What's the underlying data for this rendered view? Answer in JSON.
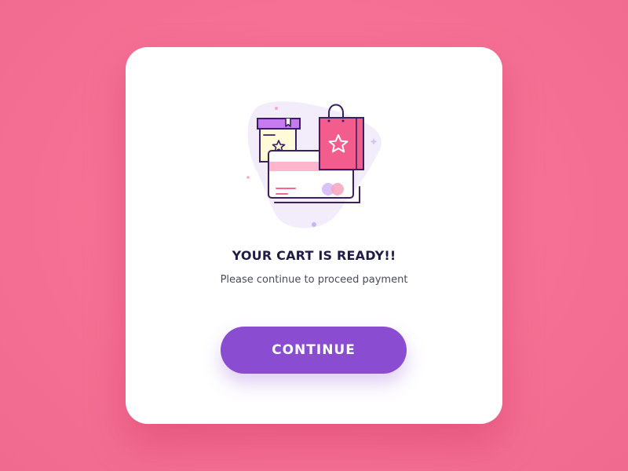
{
  "dialog": {
    "title": "YOUR CART IS READY!!",
    "subtitle": "Please continue to proceed payment",
    "continue_label": "CONTINUE"
  },
  "illustration": {
    "icons": [
      "gift-box-icon",
      "shopping-bag-icon",
      "credit-card-icon"
    ]
  },
  "colors": {
    "background": "#f77298",
    "card": "#ffffff",
    "accent": "#8a4cd0",
    "title": "#1f1d45",
    "subtitle": "#4a4a5a"
  }
}
